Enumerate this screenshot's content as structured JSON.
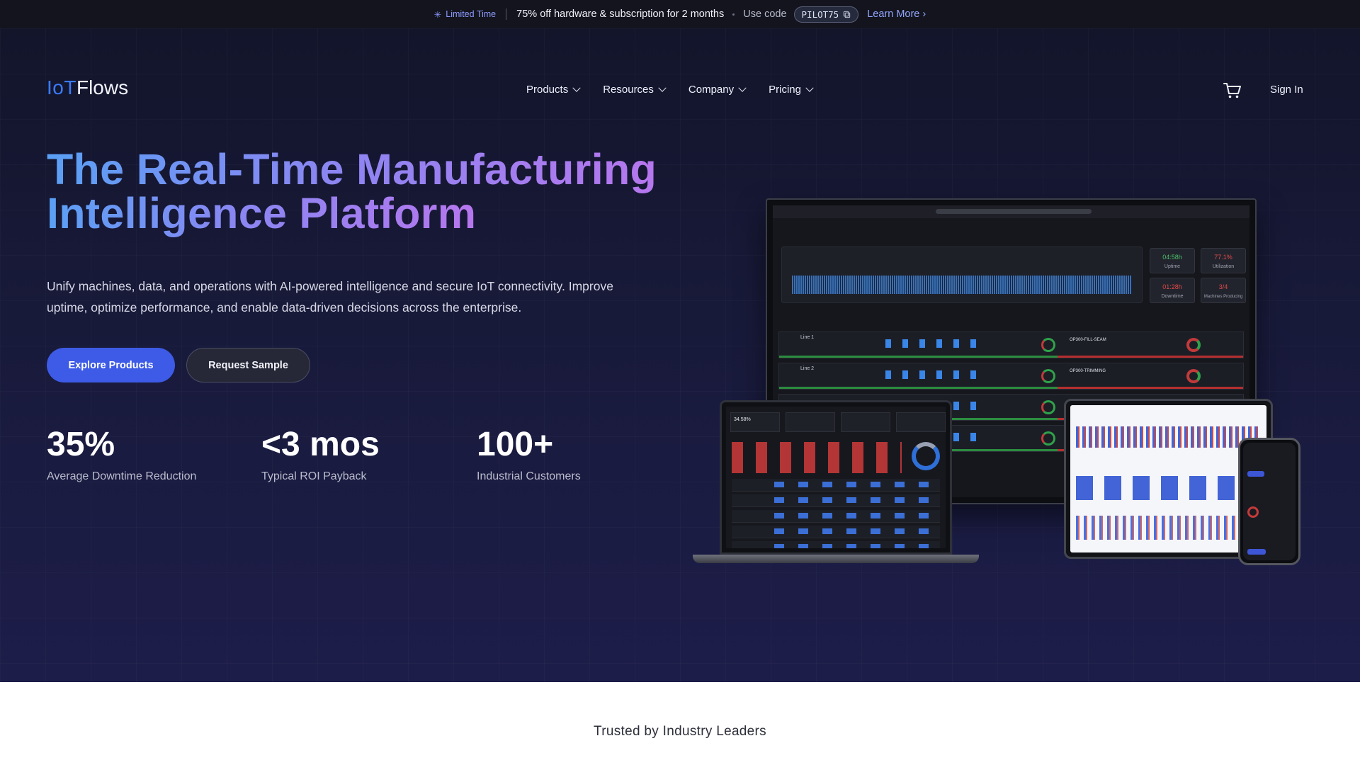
{
  "promo": {
    "tag": "Limited Time",
    "offer": "75% off hardware & subscription for 2 months",
    "use_code": "Use code",
    "code": "PILOT75",
    "learn_more": "Learn More"
  },
  "logo": {
    "iot": "IoT",
    "flows": "Flows"
  },
  "nav": {
    "items": [
      {
        "label": "Products"
      },
      {
        "label": "Resources"
      },
      {
        "label": "Company"
      },
      {
        "label": "Pricing"
      }
    ],
    "sign_in": "Sign In"
  },
  "hero": {
    "headline_line1": "The Real-Time Manufacturing",
    "headline_line2": "Intelligence Platform",
    "subtext": "Unify machines, data, and operations with AI-powered intelligence and secure IoT connectivity. Improve uptime, optimize performance, and enable data-driven decisions across the enterprise.",
    "primary_cta": "Explore Products",
    "secondary_cta": "Request Sample",
    "stats": [
      {
        "value": "35%",
        "label": "Average Downtime Reduction"
      },
      {
        "value": "<3 mos",
        "label": "Typical ROI Payback"
      },
      {
        "value": "100+",
        "label": "Industrial Customers"
      }
    ]
  },
  "dashboard": {
    "uptime": "04:58h",
    "uptime_label": "Uptime",
    "utilization": "77.1%",
    "utilization_label": "Utilization",
    "downtime": "01:28h",
    "downtime_label": "Downtime",
    "machines": "3/4",
    "machines_label": "Machines Producing",
    "line1": "Line 1",
    "line2": "Line 2",
    "op1": "OP300-FILL-SEAM",
    "op2": "OP300-TRIMMING",
    "laptop_pct": "34.58%"
  },
  "colors": {
    "accent": "#3d5be6",
    "brand_blue": "#3a7bff",
    "hero_bg": "#181a3a"
  },
  "trusted": {
    "title": "Trusted by Industry Leaders"
  }
}
